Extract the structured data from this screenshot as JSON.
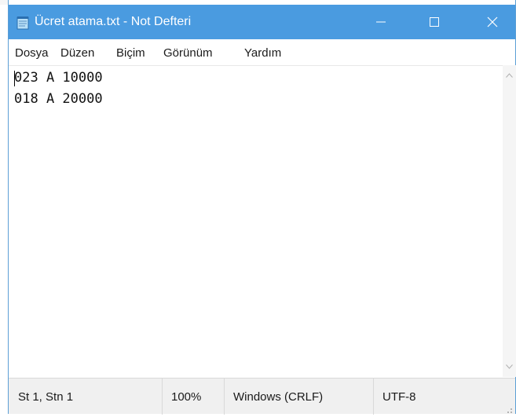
{
  "window": {
    "title": "Ücret atama.txt - Not Defteri",
    "accent_color": "#4a9be0",
    "icon": "notepad-icon"
  },
  "title_buttons": {
    "minimize_icon": "minimize-icon",
    "maximize_icon": "maximize-icon",
    "close_icon": "close-icon"
  },
  "menu": {
    "items": [
      {
        "label": "Dosya"
      },
      {
        "label": "Düzen"
      },
      {
        "label": "Biçim"
      },
      {
        "label": "Görünüm"
      },
      {
        "label": "Yardım"
      }
    ]
  },
  "editor": {
    "lines": [
      "023 A 10000",
      "018 A 20000"
    ]
  },
  "status": {
    "position": "St 1, Stn 1",
    "zoom": "100%",
    "line_ending": "Windows (CRLF)",
    "encoding": "UTF-8"
  }
}
